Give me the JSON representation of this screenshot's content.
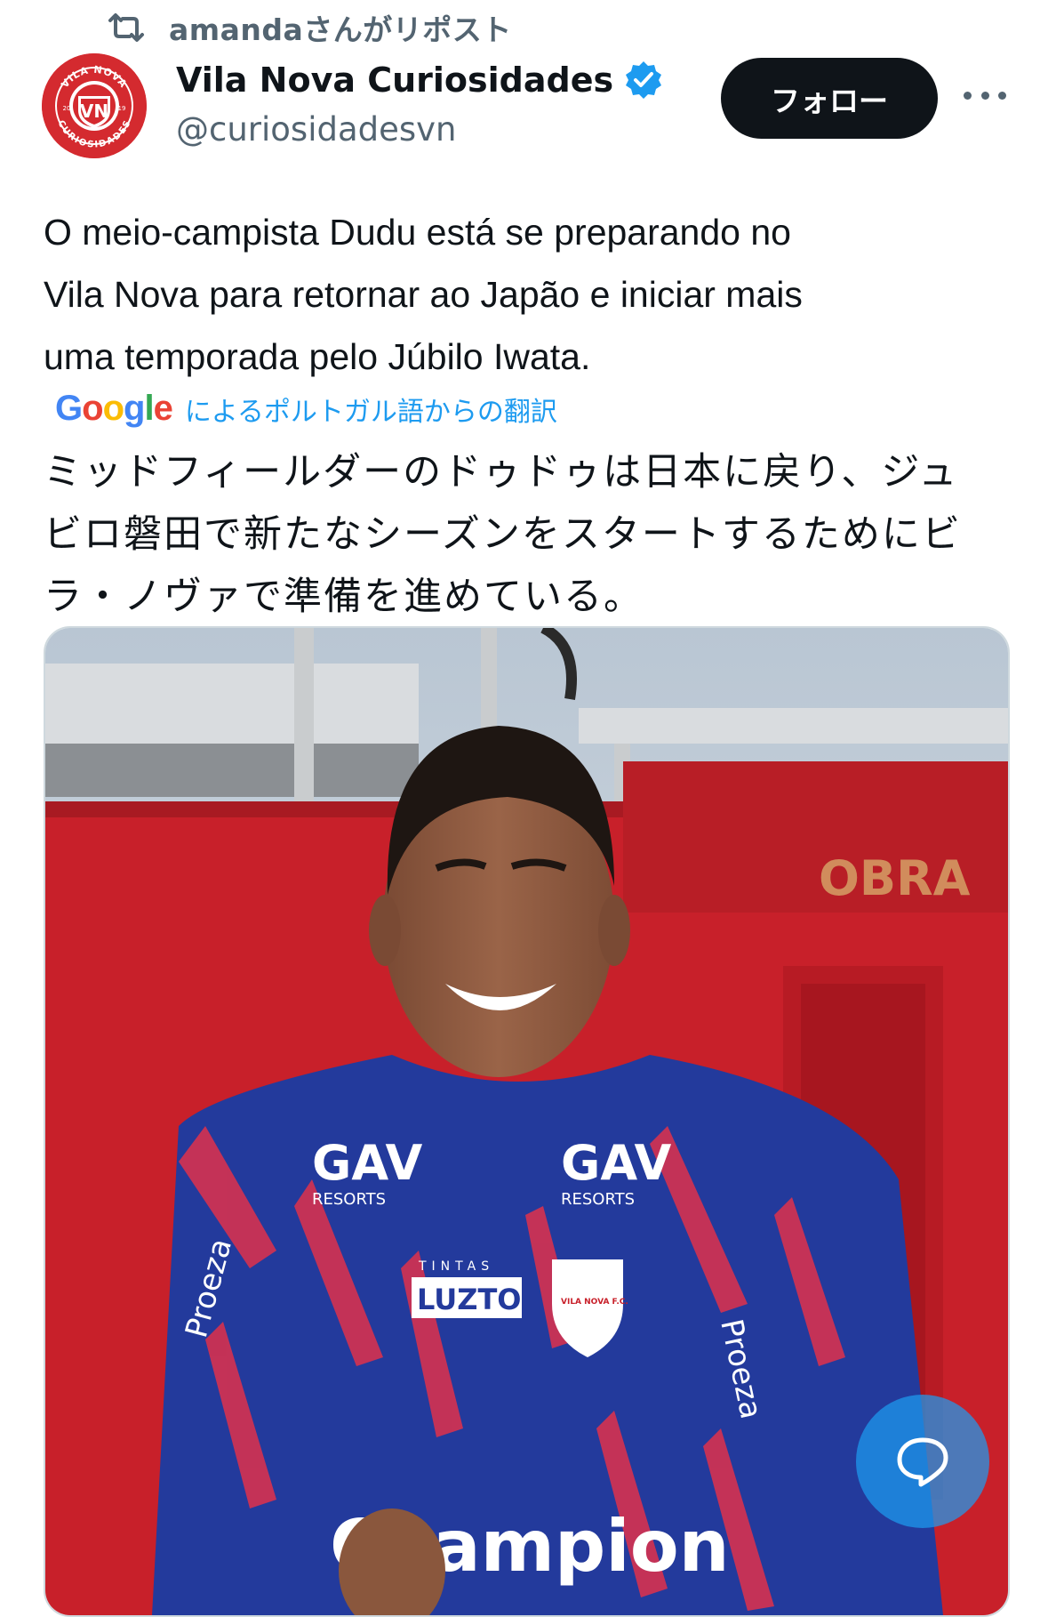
{
  "repost": {
    "text": "amandaさんがリポスト",
    "icon": "repost-icon"
  },
  "author": {
    "display_name": "Vila Nova Curiosidades",
    "handle": "@curiosidadesvn",
    "verified_icon": "verified-badge-icon",
    "avatar_logo_text": [
      "VILA NOVA",
      "VN",
      "CURIOSIDADES",
      "20",
      "19"
    ]
  },
  "actions": {
    "follow_label": "フォロー",
    "more_icon": "more-icon"
  },
  "tweet": {
    "lines": [
      "O meio-campista Dudu está se preparando no",
      "Vila Nova para retornar ao Japão e iniciar mais",
      "uma temporada pelo Júbilo Iwata."
    ]
  },
  "translation": {
    "provider_logo": "Google",
    "label": "によるポルトガル語からの翻訳",
    "lines": [
      "ミッドフィールダーのドゥドゥは日本に戻り、ジュ",
      "ビロ磐田で新たなシーズンをスタートするためにビ",
      "ラ・ノヴァで準備を進めている。"
    ]
  },
  "media": {
    "description_icon": "photo",
    "image_text": [
      "OBRA",
      "GAV",
      "RESORTS",
      "GAV",
      "RESORTS",
      "TINTAS",
      "LUZTOL",
      "VILA NOVA F.C.",
      "Proeza",
      "Proeza",
      "Champion"
    ]
  },
  "fab": {
    "icon": "chat-bubble-icon"
  },
  "colors": {
    "accent": "#1d9bf0",
    "club_red": "#d42a2f",
    "jersey_blue": "#233a9c",
    "text_secondary": "#536471"
  }
}
